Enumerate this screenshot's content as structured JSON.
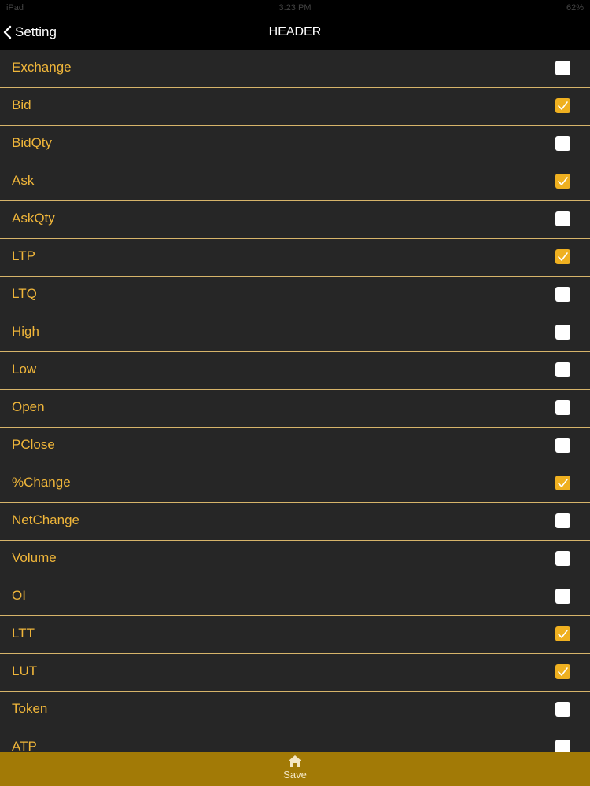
{
  "status_bar": {
    "left": "iPad",
    "time": "3:23 PM",
    "battery": "62%"
  },
  "nav": {
    "back_label": "Setting",
    "title": "HEADER"
  },
  "colors": {
    "accent": "#f0b63a",
    "checked": "#efb020",
    "tab_bar": "#a27a06",
    "divider": "#d6b46a"
  },
  "items": [
    {
      "label": "Exchange",
      "checked": false
    },
    {
      "label": "Bid",
      "checked": true
    },
    {
      "label": "BidQty",
      "checked": false
    },
    {
      "label": "Ask",
      "checked": true
    },
    {
      "label": "AskQty",
      "checked": false
    },
    {
      "label": "LTP",
      "checked": true
    },
    {
      "label": "LTQ",
      "checked": false
    },
    {
      "label": "High",
      "checked": false
    },
    {
      "label": "Low",
      "checked": false
    },
    {
      "label": "Open",
      "checked": false
    },
    {
      "label": "PClose",
      "checked": false
    },
    {
      "label": "%Change",
      "checked": true
    },
    {
      "label": "NetChange",
      "checked": false
    },
    {
      "label": "Volume",
      "checked": false
    },
    {
      "label": "OI",
      "checked": false
    },
    {
      "label": "LTT",
      "checked": true
    },
    {
      "label": "LUT",
      "checked": true
    },
    {
      "label": "Token",
      "checked": false
    },
    {
      "label": "ATP",
      "checked": false
    }
  ],
  "tab_bar": {
    "save_label": "Save",
    "save_icon": "home-icon"
  }
}
